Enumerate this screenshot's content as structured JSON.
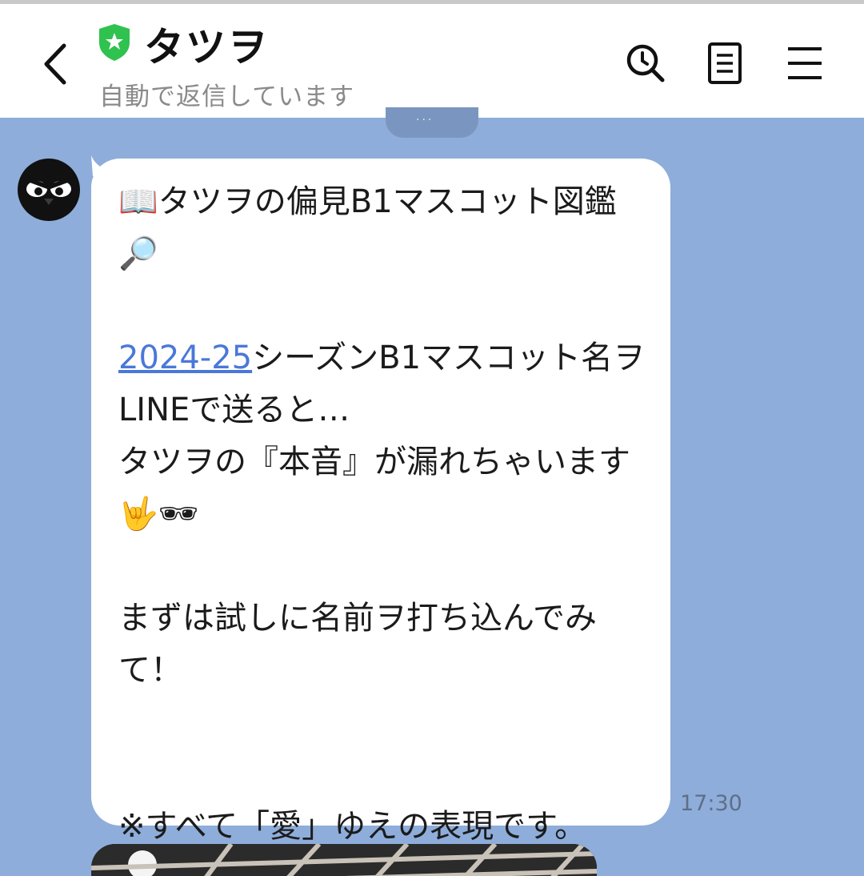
{
  "header": {
    "title": "タツヲ",
    "status": "自動で返信しています"
  },
  "icons": {
    "back": "chevron-left-icon",
    "verified": "shield-star-icon",
    "search": "search-icon",
    "notes": "note-icon",
    "menu": "hamburger-icon"
  },
  "message": {
    "line1": "📖タツヲの偏見B1マスコット図鑑🔎",
    "blank1": "",
    "link_text": "2024-25",
    "line3_rest": "シーズンB1マスコット名ヲLINEで送ると…",
    "line4": "タツヲの『本音』が漏れちゃいます🤟🕶",
    "blank2": "",
    "line5": "まずは試しに名前ヲ打ち込んでみて！",
    "blank3": "",
    "blank4": "",
    "line6": "※すべて「愛」ゆえの表現です。",
    "time": "17:30"
  },
  "colors": {
    "chat_background": "#8eadda",
    "link": "#4a78d8",
    "verified_green": "#2fc24f"
  }
}
